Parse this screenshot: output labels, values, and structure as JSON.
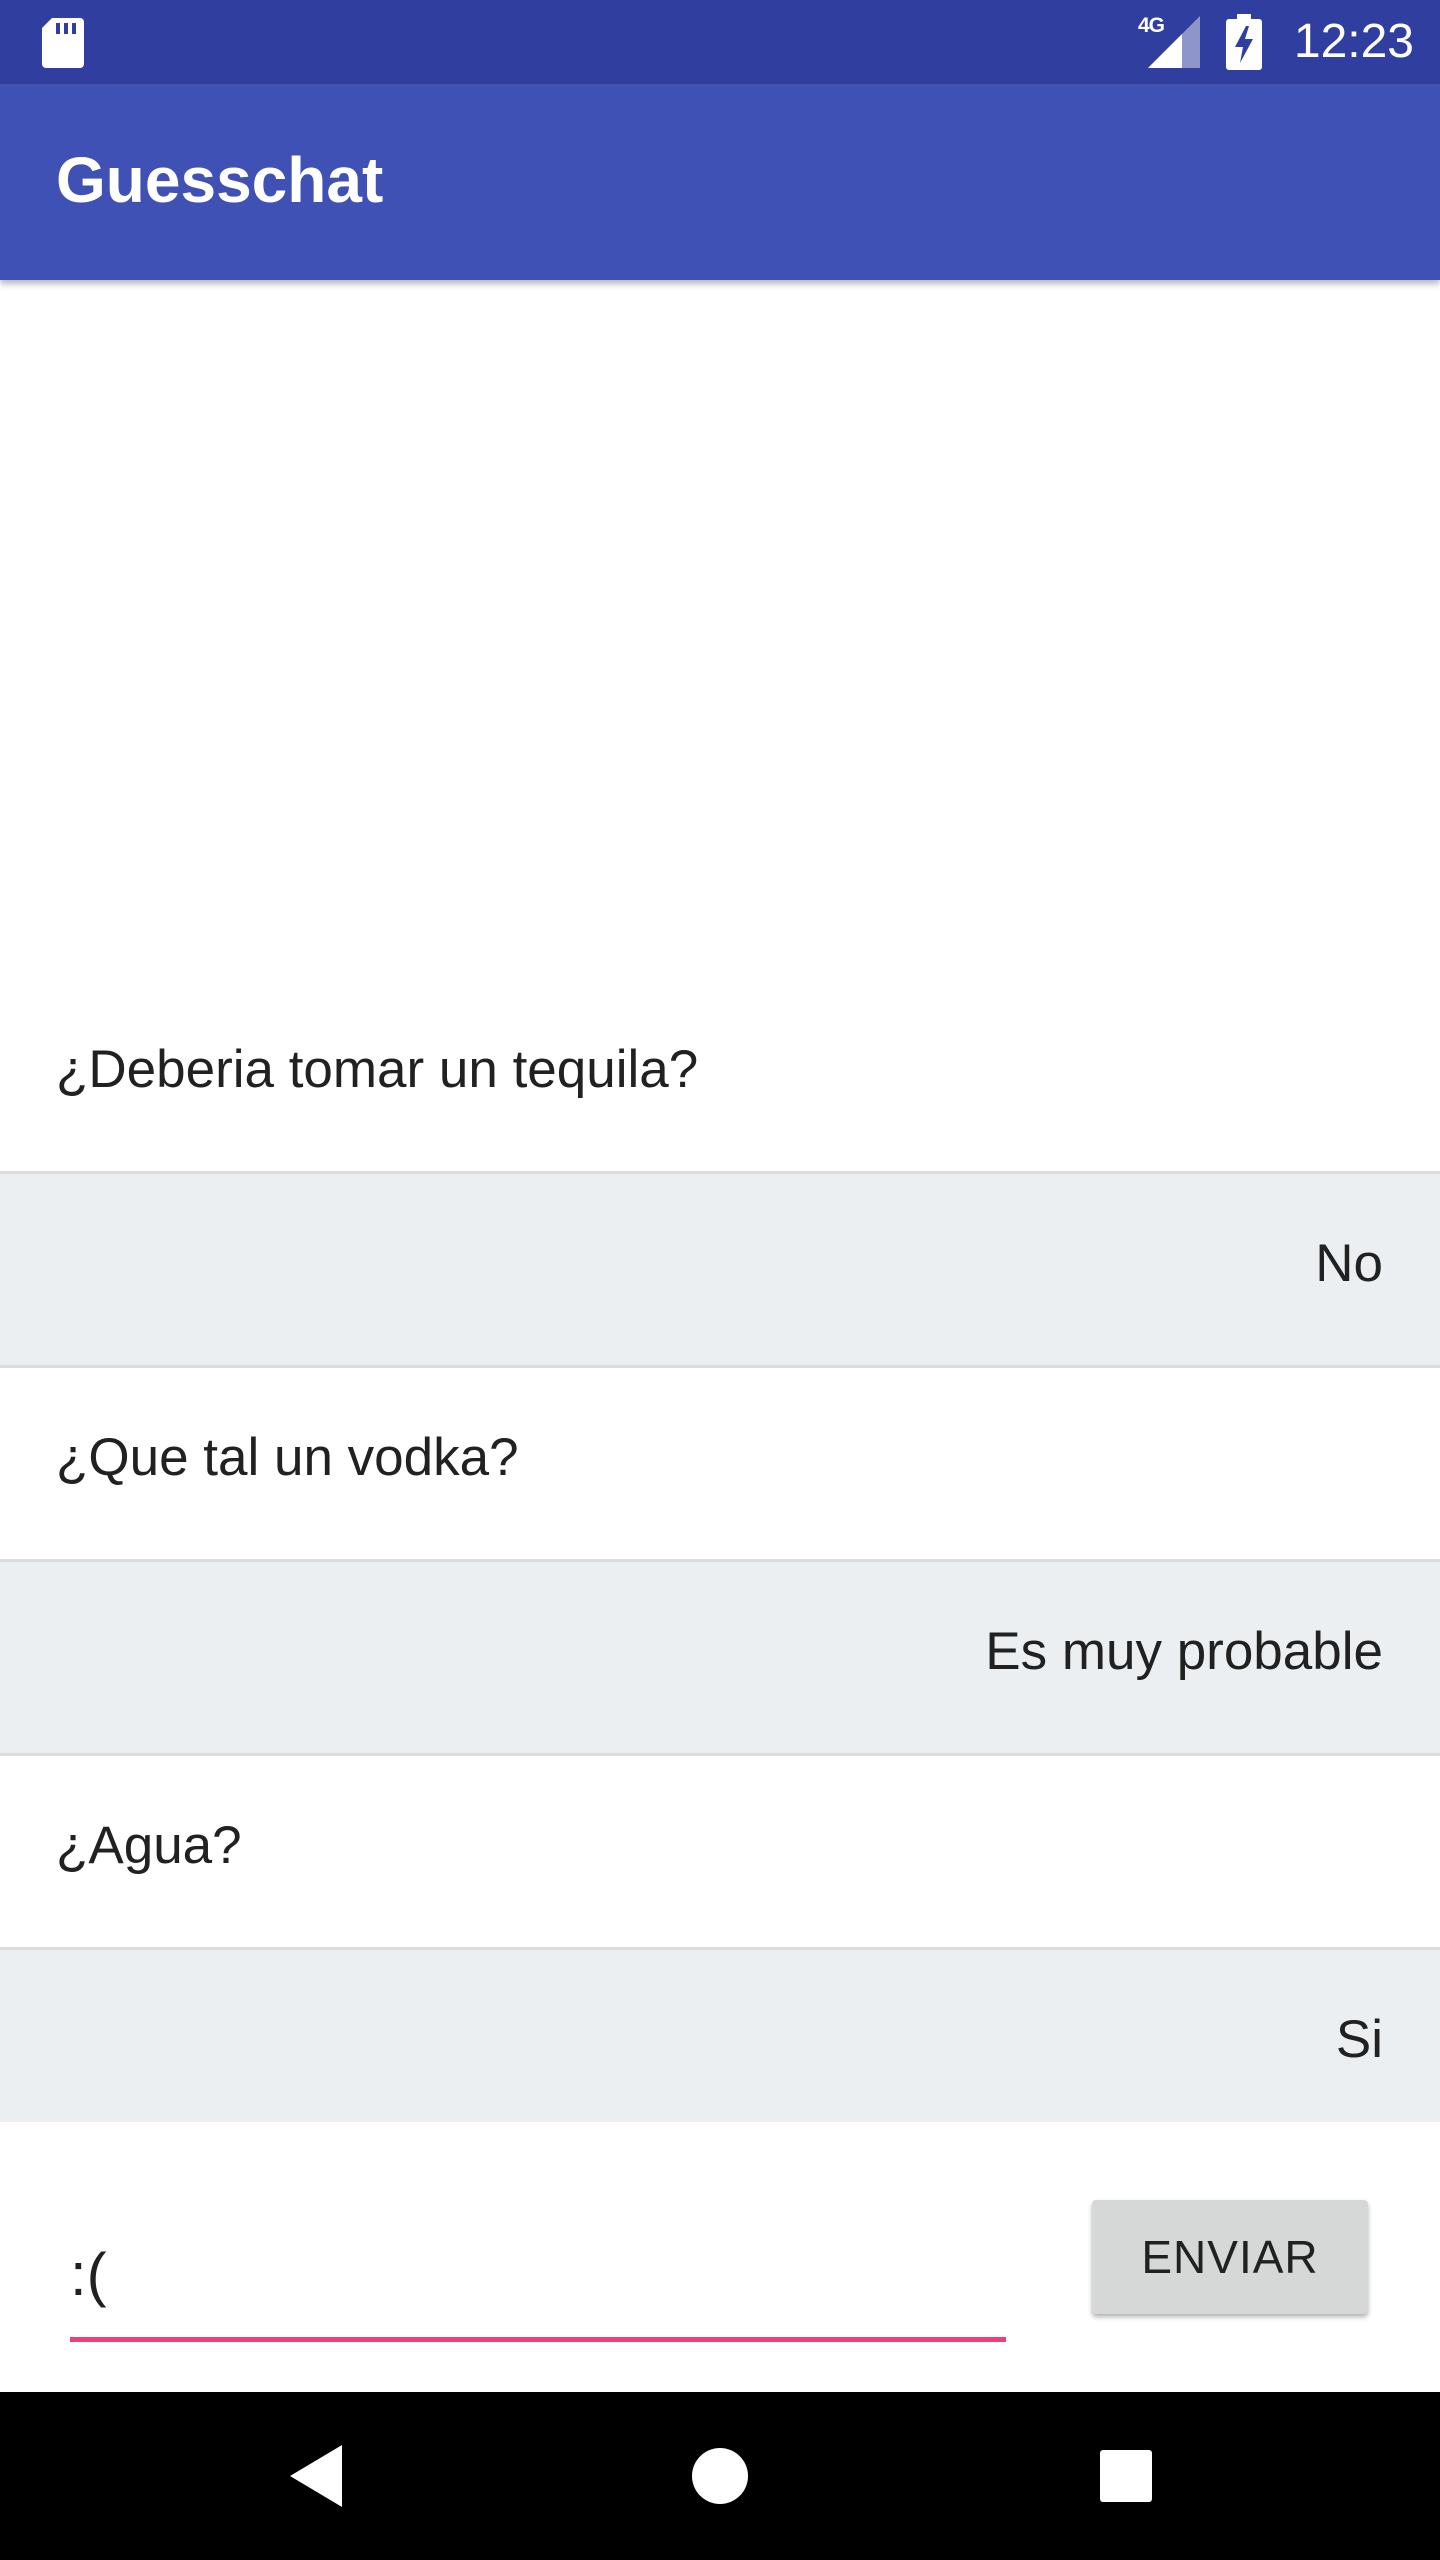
{
  "status_bar": {
    "time": "12:23",
    "network_label": "4G",
    "icons": [
      "sd-card-icon",
      "cell-signal-icon",
      "battery-charging-icon"
    ]
  },
  "app_bar": {
    "title": "Guesschat"
  },
  "messages": [
    {
      "type": "question",
      "text": "¿Deberia tomar un tequila?"
    },
    {
      "type": "answer",
      "text": "No"
    },
    {
      "type": "question",
      "text": "¿Que tal un vodka?"
    },
    {
      "type": "answer",
      "text": "Es muy probable"
    },
    {
      "type": "question",
      "text": "¿Agua?"
    },
    {
      "type": "answer",
      "text": "Si"
    }
  ],
  "input": {
    "value": ":(",
    "send_label": "ENVIAR"
  },
  "nav_bar": {
    "icons": [
      "back-icon",
      "home-icon",
      "recents-icon"
    ]
  },
  "colors": {
    "status_bar": "#303F9F",
    "app_bar": "#3F51B5",
    "answer_background": "#ECEFF1",
    "input_accent": "#EC407A",
    "send_button": "#D6D7D7"
  }
}
